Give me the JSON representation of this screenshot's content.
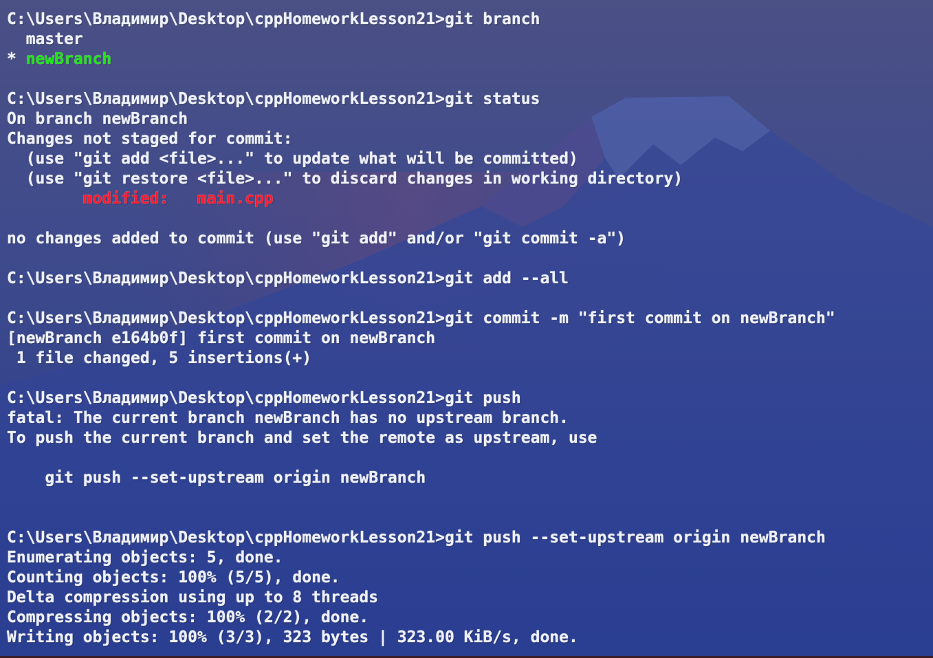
{
  "theme": {
    "text_color": "#eef1fa",
    "green": "#22e21c",
    "red": "#ff1a2e",
    "background": "#2a3d8e"
  },
  "prompt": "C:\\Users\\Владимир\\Desktop\\cppHomeworkLesson21>",
  "lines": [
    {
      "segments": [
        {
          "text": "C:\\Users\\Владимир\\Desktop\\cppHomeworkLesson21>git branch"
        }
      ]
    },
    {
      "segments": [
        {
          "text": "  master"
        }
      ]
    },
    {
      "segments": [
        {
          "text": "* "
        },
        {
          "text": "newBranch",
          "color": "green"
        }
      ]
    },
    {
      "segments": [
        {
          "text": ""
        }
      ]
    },
    {
      "segments": [
        {
          "text": "C:\\Users\\Владимир\\Desktop\\cppHomeworkLesson21>git status"
        }
      ]
    },
    {
      "segments": [
        {
          "text": "On branch newBranch"
        }
      ]
    },
    {
      "segments": [
        {
          "text": "Changes not staged for commit:"
        }
      ]
    },
    {
      "segments": [
        {
          "text": "  (use \"git add <file>...\" to update what will be committed)"
        }
      ]
    },
    {
      "segments": [
        {
          "text": "  (use \"git restore <file>...\" to discard changes in working directory)"
        }
      ]
    },
    {
      "segments": [
        {
          "text": "        "
        },
        {
          "text": "modified:   main.cpp",
          "color": "red"
        }
      ]
    },
    {
      "segments": [
        {
          "text": ""
        }
      ]
    },
    {
      "segments": [
        {
          "text": "no changes added to commit (use \"git add\" and/or \"git commit -a\")"
        }
      ]
    },
    {
      "segments": [
        {
          "text": ""
        }
      ]
    },
    {
      "segments": [
        {
          "text": "C:\\Users\\Владимир\\Desktop\\cppHomeworkLesson21>git add --all"
        }
      ]
    },
    {
      "segments": [
        {
          "text": ""
        }
      ]
    },
    {
      "segments": [
        {
          "text": "C:\\Users\\Владимир\\Desktop\\cppHomeworkLesson21>git commit -m \"first commit on newBranch\""
        }
      ]
    },
    {
      "segments": [
        {
          "text": "[newBranch e164b0f] first commit on newBranch"
        }
      ]
    },
    {
      "segments": [
        {
          "text": " 1 file changed, 5 insertions(+)"
        }
      ]
    },
    {
      "segments": [
        {
          "text": ""
        }
      ]
    },
    {
      "segments": [
        {
          "text": "C:\\Users\\Владимир\\Desktop\\cppHomeworkLesson21>git push"
        }
      ]
    },
    {
      "segments": [
        {
          "text": "fatal: The current branch newBranch has no upstream branch."
        }
      ]
    },
    {
      "segments": [
        {
          "text": "To push the current branch and set the remote as upstream, use"
        }
      ]
    },
    {
      "segments": [
        {
          "text": ""
        }
      ]
    },
    {
      "segments": [
        {
          "text": "    git push --set-upstream origin newBranch"
        }
      ]
    },
    {
      "segments": [
        {
          "text": ""
        }
      ]
    },
    {
      "segments": [
        {
          "text": ""
        }
      ]
    },
    {
      "segments": [
        {
          "text": "C:\\Users\\Владимир\\Desktop\\cppHomeworkLesson21>git push --set-upstream origin newBranch"
        }
      ]
    },
    {
      "segments": [
        {
          "text": "Enumerating objects: 5, done."
        }
      ]
    },
    {
      "segments": [
        {
          "text": "Counting objects: 100% (5/5), done."
        }
      ]
    },
    {
      "segments": [
        {
          "text": "Delta compression using up to 8 threads"
        }
      ]
    },
    {
      "segments": [
        {
          "text": "Compressing objects: 100% (2/2), done."
        }
      ]
    },
    {
      "segments": [
        {
          "text": "Writing objects: 100% (3/3), 323 bytes | 323.00 KiB/s, done."
        }
      ]
    }
  ]
}
